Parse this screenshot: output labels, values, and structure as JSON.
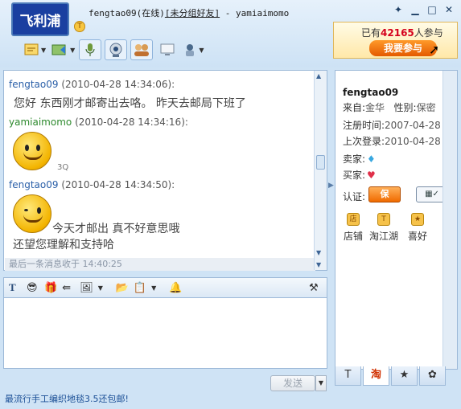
{
  "window": {
    "contact_name": "fengtao09",
    "contact_status": "(在线)",
    "contact_group": "[未分组好友]",
    "separator": " - ",
    "self_name": "yamiaimomo",
    "avatar_text": "飞利浦",
    "controls": [
      "pin-icon",
      "minimize-icon",
      "maximize-icon",
      "close-icon"
    ]
  },
  "ad_banner": {
    "prefix": "已有",
    "count": "42165",
    "suffix": "人参与",
    "button": "我要参与"
  },
  "toolbar": {
    "buttons": [
      "send-file",
      "screenshot",
      "voice",
      "video",
      "group-chat",
      "remote-assist",
      "app-menu"
    ]
  },
  "messages": [
    {
      "sender": "fengtao09",
      "time": "(2010-04-28 14:34:06):",
      "text": "您好   东西刚才邮寄出去咯。  昨天去邮局下班了"
    },
    {
      "sender": "yamiaimomo",
      "time": "(2010-04-28 14:34:16):",
      "sticker_caption": "3Q"
    },
    {
      "sender": "fengtao09",
      "time": "(2010-04-28 14:34:50):",
      "text_line1": "今天才邮出  真不好意思哦",
      "text_line2": "还望您理解和支持哈"
    }
  ],
  "last_message": "最后一条消息收于  14:40:25",
  "send_button": "发送",
  "bottom_ad": "最流行手工编织地毯3.5还包邮!",
  "profile": {
    "name": "fengtao09",
    "origin_label": "来自:",
    "origin": "金华",
    "gender_label": "性别:",
    "gender": "保密",
    "register_label": "注册时间:",
    "register_date": "2007-04-28",
    "last_login_label": "上次登录:",
    "last_login_date": "2010-04-28",
    "seller_label": "卖家:",
    "buyer_label": "买家:",
    "cert_label": "认证:",
    "guarantee_badge": "保",
    "links": [
      "店铺",
      "淘江湖",
      "喜好"
    ]
  },
  "bottom_tabs": [
    "T",
    "淘",
    "★",
    "✿"
  ]
}
